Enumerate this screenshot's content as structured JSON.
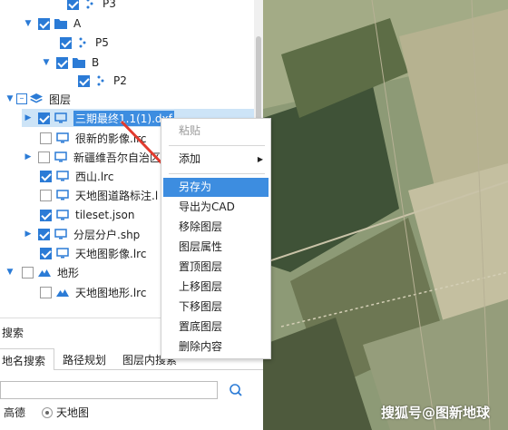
{
  "tree": {
    "items": [
      {
        "label": "P3"
      },
      {
        "label": "A"
      },
      {
        "label": "P5"
      },
      {
        "label": "B"
      },
      {
        "label": "P2"
      },
      {
        "label": "图层"
      },
      {
        "label": "三期最终1.1(1).dxf"
      },
      {
        "label": "很新的影像.lrc"
      },
      {
        "label": "新疆维吾尔自治区"
      },
      {
        "label": "西山.lrc"
      },
      {
        "label": "天地图道路标注.l"
      },
      {
        "label": "tileset.json"
      },
      {
        "label": "分层分户.shp"
      },
      {
        "label": "天地图影像.lrc"
      },
      {
        "label": "地形"
      },
      {
        "label": "天地图地形.lrc"
      }
    ]
  },
  "context_menu": {
    "items": [
      {
        "label": "粘贴"
      },
      {
        "label": "添加"
      },
      {
        "label": "另存为"
      },
      {
        "label": "导出为CAD"
      },
      {
        "label": "移除图层"
      },
      {
        "label": "图层属性"
      },
      {
        "label": "置顶图层"
      },
      {
        "label": "上移图层"
      },
      {
        "label": "下移图层"
      },
      {
        "label": "置底图层"
      },
      {
        "label": "删除内容"
      }
    ]
  },
  "search_panel": {
    "header": "搜索",
    "tabs": [
      {
        "label": "地名搜索"
      },
      {
        "label": "路径规划"
      },
      {
        "label": "图层内搜索"
      }
    ],
    "search_value": "",
    "sources": [
      {
        "label": "高德",
        "selected": false
      },
      {
        "label": "天地图",
        "selected": true
      }
    ]
  },
  "watermark": "搜狐号@图新地球",
  "colors": {
    "accent": "#2b7bd6",
    "menu_highlight": "#3d8de0",
    "selection": "#cde4f7",
    "arrow": "#e23b2e"
  }
}
